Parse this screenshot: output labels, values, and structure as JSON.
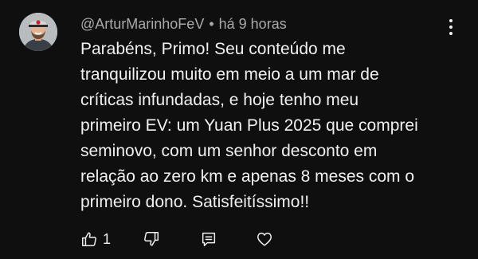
{
  "comment": {
    "author": "@ArturMarinhoFeV",
    "separator": "•",
    "time": "há 9 horas",
    "text": "Parabéns, Primo! Seu conteúdo me\ntranquilizou muito em meio a um mar de\ncríticas infundadas, e hoje tenho meu\nprimeiro EV: um Yuan Plus 2025 que comprei\nseminovo, com um senhor desconto em\nrelação ao zero km e apenas 8 meses com o\nprimeiro dono. Satisfeitíssimo!!",
    "like_count": "1"
  },
  "icons": {
    "like": "thumbs-up-icon",
    "dislike": "thumbs-down-icon",
    "reply": "reply-icon",
    "heart": "heart-icon",
    "menu": "more-vert-icon"
  },
  "colors": {
    "background": "#0f0f0f",
    "text": "#f1f1f1",
    "meta": "#aaaaaa"
  }
}
